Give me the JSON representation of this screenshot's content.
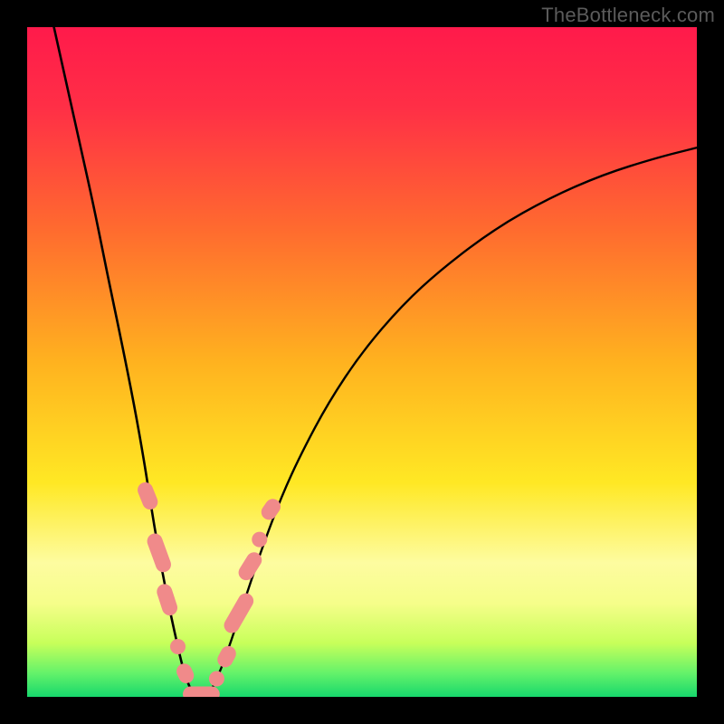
{
  "watermark": "TheBottleneck.com",
  "chart_data": {
    "type": "line",
    "title": "",
    "xlabel": "",
    "ylabel": "",
    "xlim": [
      0,
      100
    ],
    "ylim": [
      0,
      100
    ],
    "gradient_stops": [
      {
        "offset": 0.0,
        "color": "#ff1a4b"
      },
      {
        "offset": 0.12,
        "color": "#ff2f46"
      },
      {
        "offset": 0.3,
        "color": "#ff6a2f"
      },
      {
        "offset": 0.5,
        "color": "#ffb21f"
      },
      {
        "offset": 0.68,
        "color": "#ffe824"
      },
      {
        "offset": 0.8,
        "color": "#fdfca0"
      },
      {
        "offset": 0.86,
        "color": "#f6fe8a"
      },
      {
        "offset": 0.92,
        "color": "#c7ff5a"
      },
      {
        "offset": 0.965,
        "color": "#63f26a"
      },
      {
        "offset": 1.0,
        "color": "#17d86c"
      }
    ],
    "series": [
      {
        "name": "left-curve",
        "x": [
          4.0,
          6.0,
          8.0,
          10.0,
          12.0,
          14.0,
          16.0,
          17.5,
          18.5,
          19.5,
          20.5,
          21.5,
          22.5,
          23.2,
          24.0,
          25.0
        ],
        "y": [
          100.0,
          91.0,
          82.0,
          73.0,
          63.0,
          53.5,
          43.5,
          35.0,
          28.5,
          22.5,
          17.0,
          12.0,
          7.5,
          4.5,
          2.0,
          0.0
        ]
      },
      {
        "name": "right-curve",
        "x": [
          27.0,
          28.5,
          30.0,
          31.5,
          33.0,
          35.0,
          38.0,
          41.0,
          45.0,
          50.0,
          56.0,
          62.0,
          70.0,
          78.0,
          86.0,
          94.0,
          100.0
        ],
        "y": [
          0.0,
          3.0,
          7.0,
          11.5,
          16.0,
          22.0,
          30.0,
          36.5,
          44.0,
          51.5,
          58.5,
          64.0,
          70.0,
          74.5,
          78.0,
          80.5,
          82.0
        ]
      }
    ],
    "markers": [
      {
        "shape": "pill",
        "x": 18.0,
        "y": 30.0,
        "angle": 68,
        "len": 4.2
      },
      {
        "shape": "pill",
        "x": 19.7,
        "y": 21.5,
        "angle": 70,
        "len": 6.0
      },
      {
        "shape": "pill",
        "x": 20.9,
        "y": 14.5,
        "angle": 72,
        "len": 4.8
      },
      {
        "shape": "dot",
        "x": 22.5,
        "y": 7.5
      },
      {
        "shape": "pill",
        "x": 23.6,
        "y": 3.5,
        "angle": 65,
        "len": 3.0
      },
      {
        "shape": "pill",
        "x": 26.0,
        "y": 0.4,
        "angle": 0,
        "len": 5.5
      },
      {
        "shape": "dot",
        "x": 28.3,
        "y": 2.7
      },
      {
        "shape": "pill",
        "x": 29.8,
        "y": 6.0,
        "angle": -62,
        "len": 3.3
      },
      {
        "shape": "pill",
        "x": 31.6,
        "y": 12.5,
        "angle": -60,
        "len": 6.5
      },
      {
        "shape": "pill",
        "x": 33.3,
        "y": 19.5,
        "angle": -58,
        "len": 4.5
      },
      {
        "shape": "dot",
        "x": 34.7,
        "y": 23.5
      },
      {
        "shape": "pill",
        "x": 36.4,
        "y": 28.0,
        "angle": -55,
        "len": 3.3
      }
    ],
    "marker_style": {
      "fill": "#f08a8a",
      "radius_pct": 1.15
    }
  }
}
